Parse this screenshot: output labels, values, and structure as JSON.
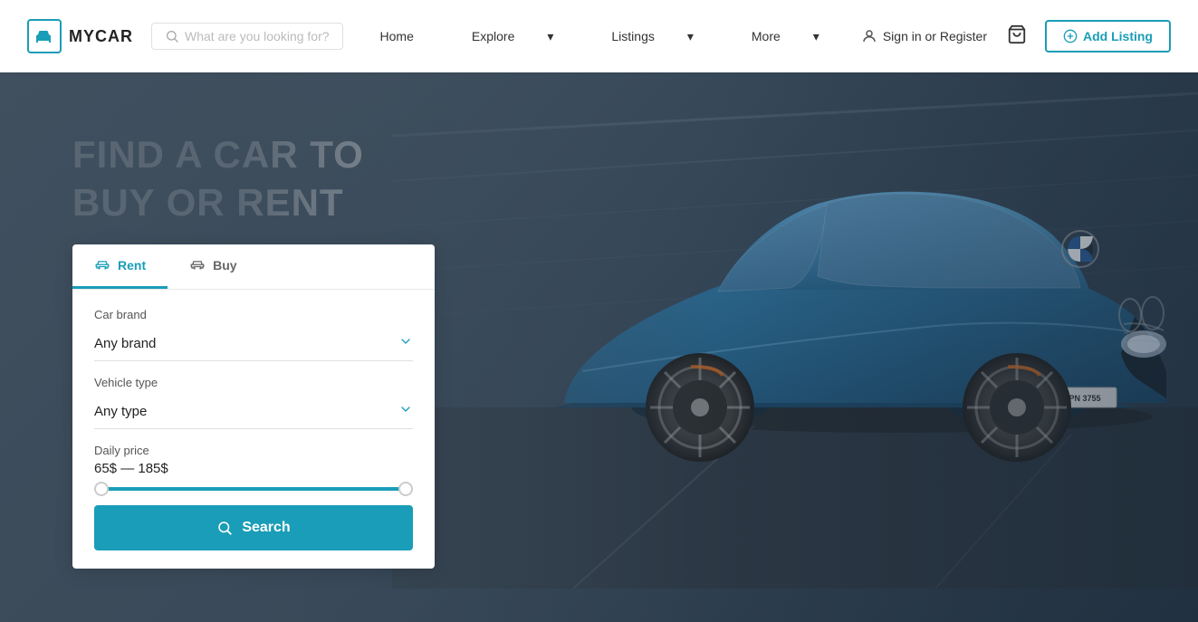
{
  "brand": {
    "logo_alt": "MyCar Logo",
    "name": "MYCAR"
  },
  "navbar": {
    "search_placeholder": "What are you looking for?",
    "nav_items": [
      {
        "label": "Home",
        "has_dropdown": false
      },
      {
        "label": "Explore",
        "has_dropdown": true
      },
      {
        "label": "Listings",
        "has_dropdown": true
      },
      {
        "label": "More",
        "has_dropdown": true
      }
    ],
    "signin_label": "Sign in or Register",
    "add_listing_label": "Add Listing"
  },
  "hero": {
    "title_line1": "FIND A CAR TO",
    "title_line2": "BUY OR RENT"
  },
  "search_panel": {
    "tab_rent": "Rent",
    "tab_buy": "Buy",
    "car_brand_label": "Car brand",
    "car_brand_value": "Any brand",
    "vehicle_type_label": "Vehicle type",
    "vehicle_type_value": "Any type",
    "daily_price_label": "Daily price",
    "price_range": "65$ — 185$",
    "search_button_label": "Search"
  }
}
